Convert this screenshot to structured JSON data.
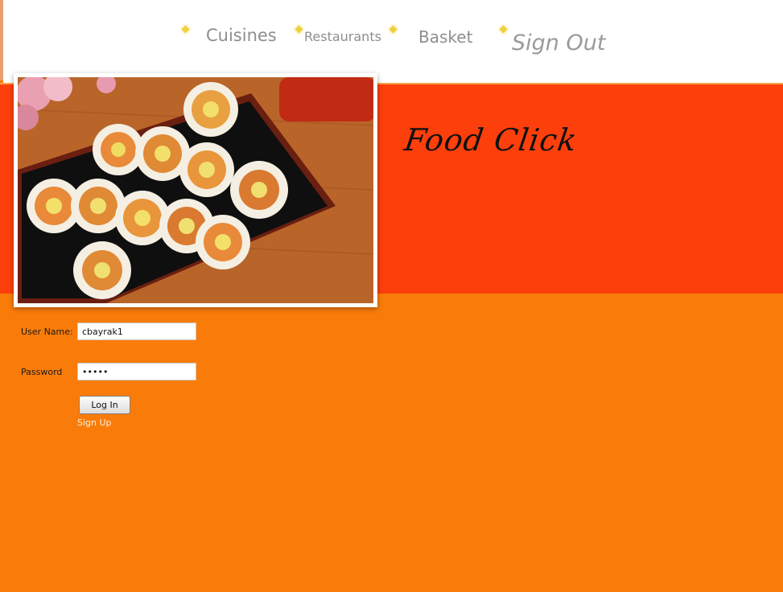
{
  "nav": {
    "items": [
      {
        "label": "Cuisines"
      },
      {
        "label": "Restaurants"
      },
      {
        "label": "Basket"
      },
      {
        "label": "Sign Out"
      }
    ]
  },
  "hero": {
    "brand": "Food Click",
    "image_alt": "Kimbap rolls on a black tray"
  },
  "login": {
    "username_label": "User Name:",
    "username_value": "cbayrak1",
    "password_label": "Password",
    "password_value": "•••••",
    "login_button": "Log In",
    "signup_link": "Sign Up"
  },
  "colors": {
    "header_bg": "#ffffff",
    "hero_bg": "#fd3f0c",
    "page_bg": "#f97c0a",
    "nav_text": "#8e8e8e",
    "diamond": "#f0d040"
  }
}
